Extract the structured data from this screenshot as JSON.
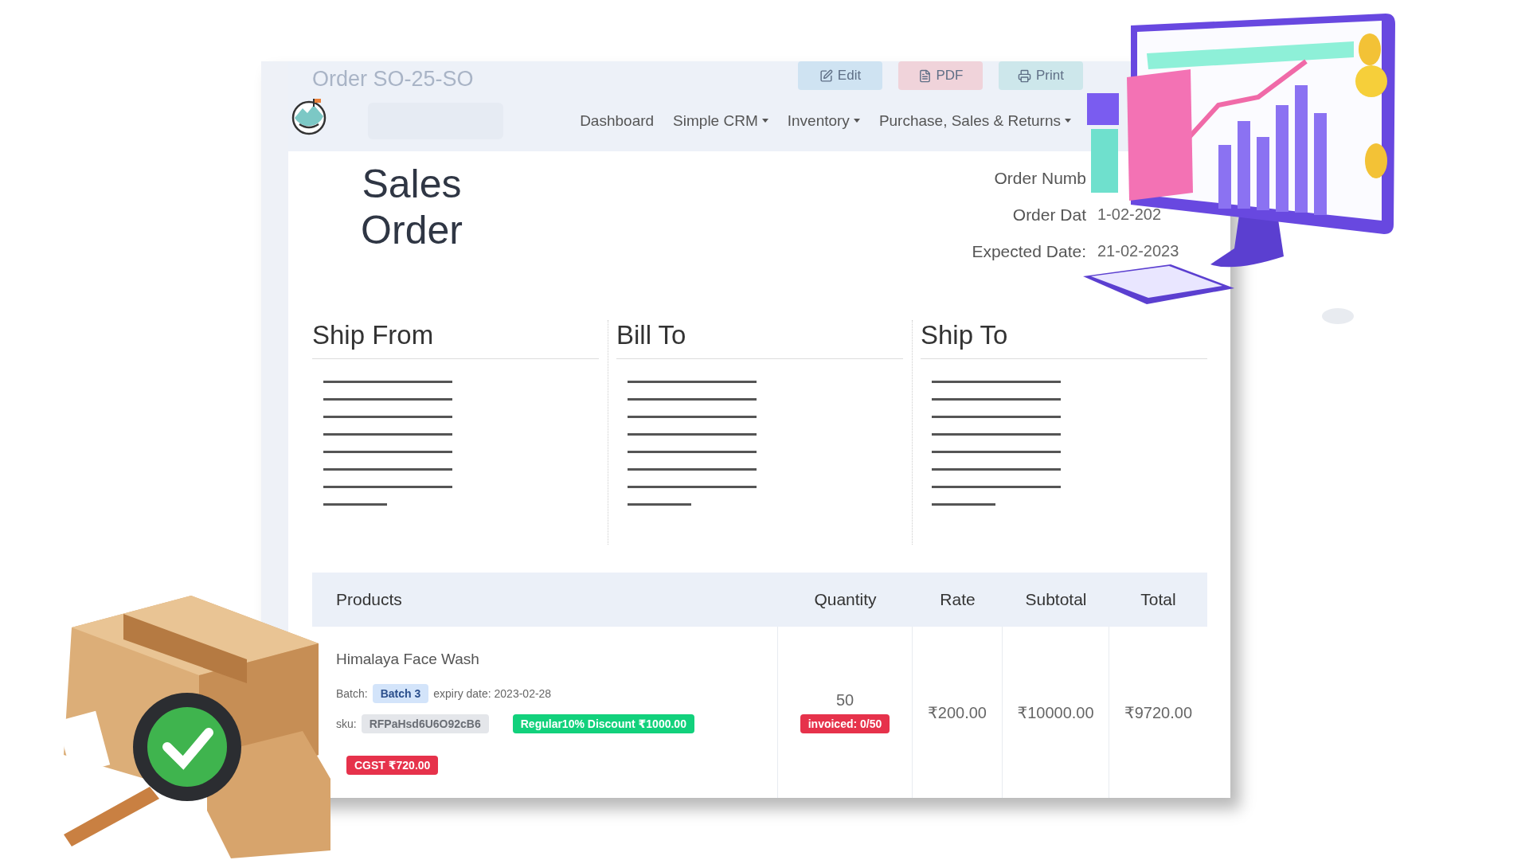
{
  "header": {
    "title": "Order SO-25-SO",
    "buttons": [
      {
        "label": "Edit",
        "kind": "edit"
      },
      {
        "label": "PDF",
        "kind": "pdf"
      },
      {
        "label": "Print",
        "kind": "print"
      }
    ]
  },
  "nav": {
    "items": [
      {
        "label": "Dashboard",
        "dropdown": false
      },
      {
        "label": "Simple CRM",
        "dropdown": true
      },
      {
        "label": "Inventory",
        "dropdown": true
      },
      {
        "label": "Purchase, Sales & Returns",
        "dropdown": true
      }
    ]
  },
  "document": {
    "title": "Sales Order",
    "meta": [
      {
        "label": "Order Numb"
      },
      {
        "label": "Order Dat",
        "value": "1-02-202"
      },
      {
        "label": "Expected Date:",
        "value": "21-02-2023"
      }
    ]
  },
  "addresses": [
    {
      "title": "Ship From"
    },
    {
      "title": "Bill To"
    },
    {
      "title": "Ship To"
    }
  ],
  "table": {
    "columns": [
      "Products",
      "Quantity",
      "Rate",
      "Subtotal",
      "Total"
    ],
    "rows": [
      {
        "product": "Himalaya Face Wash",
        "batch_label": "Batch:",
        "batch": "Batch 3",
        "expiry": "expiry date: 2023-02-28",
        "sku_label": "sku:",
        "sku": "RFPaHsd6U6O92cB6",
        "discount": "Regular10% Discount ₹1000.00",
        "tax": "CGST ₹720.00",
        "quantity": "50",
        "invoiced": "invoiced: 0/50",
        "rate": "₹200.00",
        "subtotal": "₹10000.00",
        "total": "₹9720.00"
      }
    ]
  }
}
